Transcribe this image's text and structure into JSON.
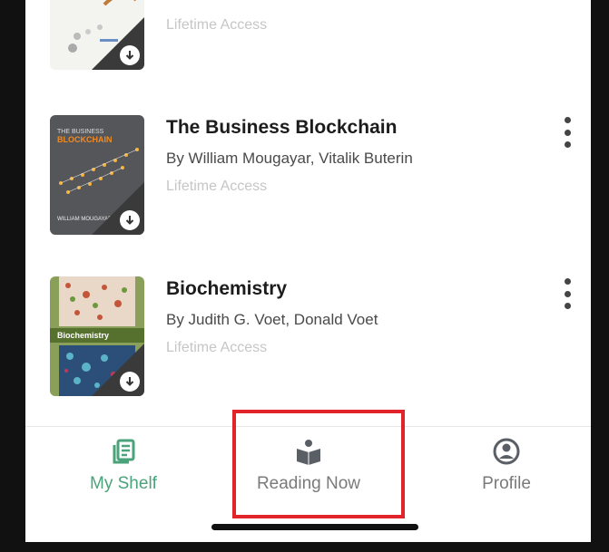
{
  "books": [
    {
      "title": "",
      "author": "",
      "access": "Lifetime Access"
    },
    {
      "title": "The Business Blockchain",
      "author": "By William Mougayar, Vitalik Buterin",
      "access": "Lifetime Access",
      "cover_text_top": "THE BUSINESS",
      "cover_text_mid": "BLOCKCHAIN",
      "cover_text_bottom": "WILLIAM MOUGAYAR"
    },
    {
      "title": "Biochemistry",
      "author": "By Judith G. Voet, Donald Voet",
      "access": "Lifetime Access",
      "cover_text_mid": "Biochemistry"
    }
  ],
  "nav": {
    "my_shelf": "My Shelf",
    "reading_now": "Reading Now",
    "profile": "Profile"
  },
  "colors": {
    "active": "#4aa37a",
    "inactive": "#7a7a7a",
    "highlight": "#e0242a"
  }
}
